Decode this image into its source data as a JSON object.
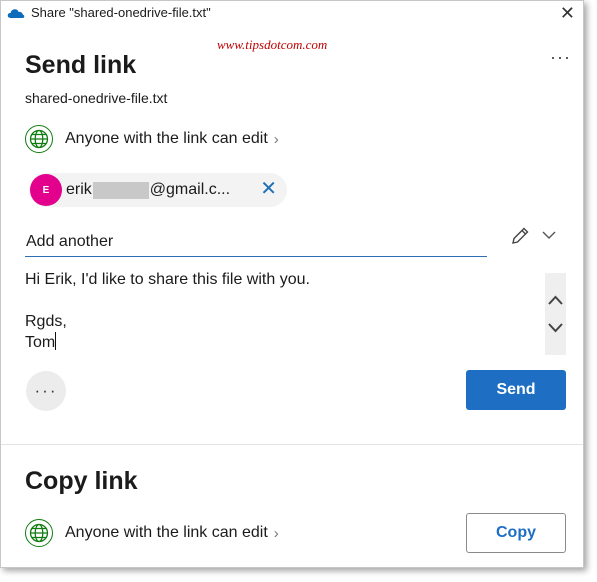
{
  "window": {
    "title": "Share \"shared-onedrive-file.txt\"",
    "close_glyph": "✕",
    "watermark": "www.tipsdotcom.com",
    "more_glyph": "···"
  },
  "send_link": {
    "heading": "Send link",
    "file_name": "shared-onedrive-file.txt",
    "permission": "Anyone with the link can edit",
    "chevron": "›",
    "recipient": {
      "initial": "E",
      "email_prefix": "erik",
      "email_suffix": "@gmail.c...",
      "avatar_color": "#e3008c",
      "remove_glyph": "✕"
    },
    "add_placeholder": "Add another",
    "message": "Hi Erik, I'd like to share this file with you.\n\nRgds,\nTom",
    "more_options_glyph": "···",
    "send_label": "Send"
  },
  "copy_link": {
    "heading": "Copy link",
    "permission": "Anyone with the link can edit",
    "chevron": "›",
    "copy_label": "Copy"
  },
  "colors": {
    "accent": "#1e6fc3",
    "globe": "#107c10",
    "watermark": "#c00000"
  },
  "icons": [
    "onedrive-cloud-icon",
    "close-icon",
    "more-icon",
    "globe-icon",
    "chevron-right-icon",
    "pencil-icon",
    "chevron-down-icon",
    "scroll-up-icon",
    "scroll-down-icon"
  ]
}
